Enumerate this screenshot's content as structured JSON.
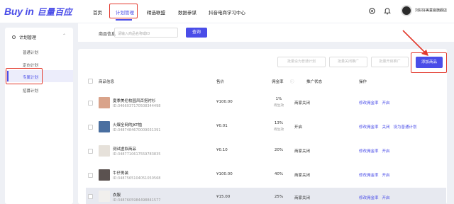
{
  "logo": {
    "en": "Buy in",
    "cn": "巨量百应"
  },
  "nav": {
    "items": [
      {
        "label": "首页",
        "active": false
      },
      {
        "label": "计划管理",
        "active": true
      },
      {
        "label": "精选联盟",
        "active": false
      },
      {
        "label": "数据参谋",
        "active": false
      },
      {
        "label": "抖音电商学习中心",
        "active": false
      }
    ]
  },
  "header": {
    "icons": [
      "settings-icon",
      "bell-icon"
    ],
    "user_name": "刘好好美童官旗舰店"
  },
  "sidebar": {
    "section_label": "计划管理",
    "items": [
      {
        "label": "普通计划",
        "active": false
      },
      {
        "label": "定向计划",
        "active": false
      },
      {
        "label": "专属计划",
        "active": true
      },
      {
        "label": "招募计划",
        "active": false
      }
    ]
  },
  "filter": {
    "label": "商品信息",
    "placeholder": "请输入商品名称或ID",
    "query_label": "查询"
  },
  "bulk_actions": {
    "set_normal": "批量设为普通计划",
    "close_promo": "批量关闭推广",
    "open_promo": "批量开启推广",
    "add_product": "添加商品"
  },
  "table": {
    "columns": [
      "商品信息",
      "售价",
      "佣金率",
      "推广状态",
      "操作"
    ],
    "rows": [
      {
        "name": "夏季美伦校园风百搭衬衫",
        "id": "ID:3466037170508344498",
        "price": "¥100.00",
        "commission": "1%",
        "commission_note": "待生效",
        "status": "商家关闭",
        "actions": [
          "修改佣金率",
          "开启"
        ]
      },
      {
        "name": "火爆全网的JKT恤",
        "id": "ID:3487484670009031391",
        "price": "¥0.01",
        "commission": "13%",
        "commission_note": "待生效",
        "status": "开启",
        "actions": [
          "修改佣金率",
          "关闭",
          "设为普通计划"
        ]
      },
      {
        "name": "测试虚拟商品",
        "id": "ID:3487710617559783835",
        "price": "¥0.10",
        "commission": "20%",
        "commission_note": "",
        "status": "商家关闭",
        "actions": [
          "修改佣金率",
          "开启"
        ]
      },
      {
        "name": "牛仔男装",
        "id": "ID:3487565104051050568",
        "price": "¥100.00",
        "commission": "40%",
        "commission_note": "",
        "status": "商家关闭",
        "actions": [
          "修改佣金率",
          "开启"
        ]
      },
      {
        "name": "衣服",
        "id": "ID:3487605984498841577",
        "price": "¥15.00",
        "commission": "25%",
        "commission_note": "",
        "status": "商家关闭",
        "actions": [
          "修改佣金率",
          "开启"
        ]
      }
    ]
  },
  "colors": {
    "accent": "#4a4de8",
    "annotation": "#e33a2e"
  }
}
